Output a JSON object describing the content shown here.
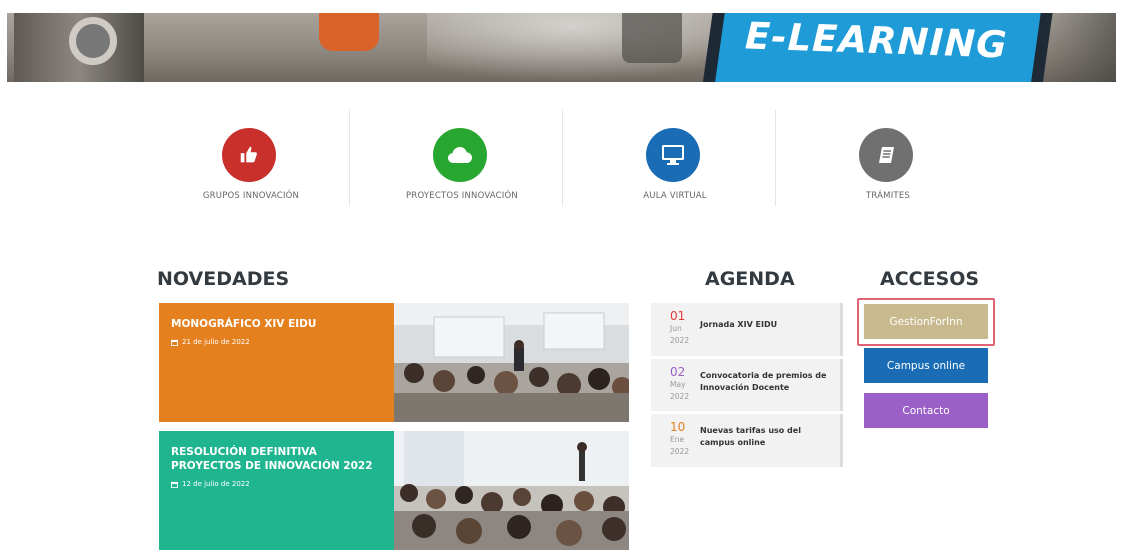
{
  "banner": {
    "text": "E-LEARNING"
  },
  "features": [
    {
      "label": "GRUPOS INNOVACIÓN",
      "icon": "thumbs-up-icon",
      "color": "#c9302c"
    },
    {
      "label": "PROYECTOS INNOVACIÓN",
      "icon": "cloud-icon",
      "color": "#27a630"
    },
    {
      "label": "AULA VIRTUAL",
      "icon": "monitor-icon",
      "color": "#1a6db5"
    },
    {
      "label": "TRÁMITES",
      "icon": "book-icon",
      "color": "#707070"
    }
  ],
  "sections": {
    "news": "NOVEDADES",
    "agenda": "AGENDA",
    "access": "ACCESOS"
  },
  "news": [
    {
      "title": "MONOGRÁFICO XIV EIDU",
      "date": "21 de julio de 2022",
      "color": "#e5801f"
    },
    {
      "title": "RESOLUCIÓN DEFINITIVA PROYECTOS DE INNOVACIÓN 2022",
      "date": "12 de julio de 2022",
      "color": "#1fb58f"
    }
  ],
  "agenda": [
    {
      "day": "01",
      "month": "Jun",
      "year": "2022",
      "text": "Jornada XIV EIDU",
      "day_color": "#e03a3a"
    },
    {
      "day": "02",
      "month": "May",
      "year": "2022",
      "text": "Convocatoria de premios de Innovación Docente",
      "day_color": "#9a5fc2"
    },
    {
      "day": "10",
      "month": "Ene",
      "year": "2022",
      "text": "Nuevas tarifas uso del campus online",
      "day_color": "#e5801f"
    }
  ],
  "access": [
    {
      "label": "GestionForInn",
      "color": "#c9b98f"
    },
    {
      "label": "Campus online",
      "color": "#1a6db5"
    },
    {
      "label": "Contacto",
      "color": "#9b5fc8"
    }
  ]
}
